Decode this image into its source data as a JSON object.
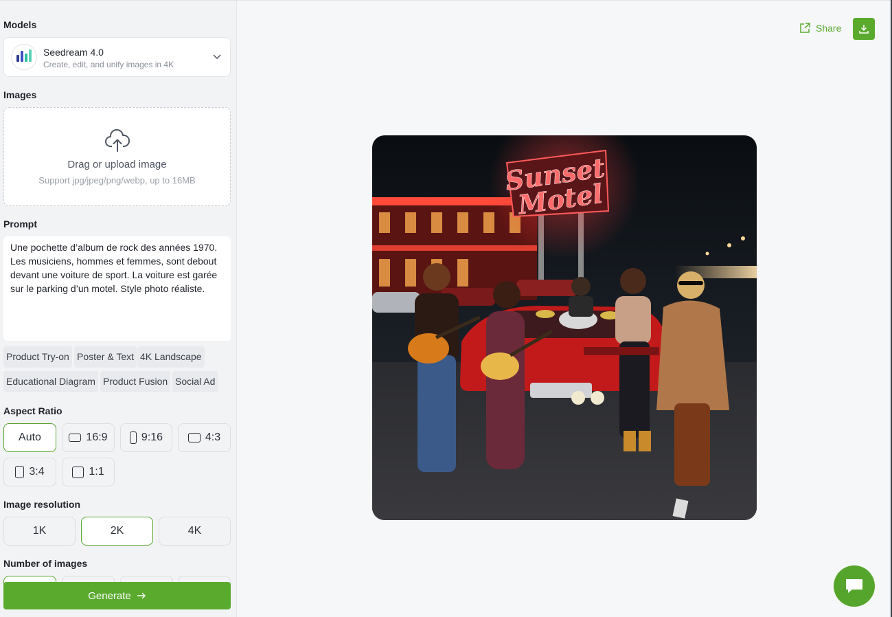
{
  "sidebar": {
    "models_label": "Models",
    "model": {
      "name": "Seedream 4.0",
      "description": "Create, edit, and unify images in 4K"
    },
    "images_label": "Images",
    "upload": {
      "title": "Drag or upload image",
      "subtitle": "Support jpg/jpeg/png/webp, up to 16MB"
    },
    "prompt_label": "Prompt",
    "prompt_text": "Une pochette d’album de rock des années 1970. Les musiciens, hommes et femmes, sont debout devant une voiture de sport. La voiture est garée sur le parking d’un motel. Style photo réaliste.",
    "tags": [
      "Product Try-on",
      "Poster & Text",
      "4K Landscape",
      "Educational Diagram",
      "Product Fusion",
      "Social Ad"
    ],
    "aspect_ratio_label": "Aspect Ratio",
    "aspect_ratios": [
      "Auto",
      "16:9",
      "9:16",
      "4:3",
      "3:4",
      "1:1"
    ],
    "aspect_ratio_selected": "Auto",
    "resolution_label": "Image resolution",
    "resolutions": [
      "1K",
      "2K",
      "4K"
    ],
    "resolution_selected": "2K",
    "num_images_label": "Number of images",
    "generate_label": "Generate"
  },
  "main": {
    "share_label": "Share",
    "download_icon": "download-icon",
    "result_image": {
      "sign_line1": "Sunset",
      "sign_line2": "Motel"
    },
    "chat_icon": "chat-bubble-icon"
  },
  "colors": {
    "accent": "#5aaa2e",
    "neon": "#ff3b3b"
  }
}
